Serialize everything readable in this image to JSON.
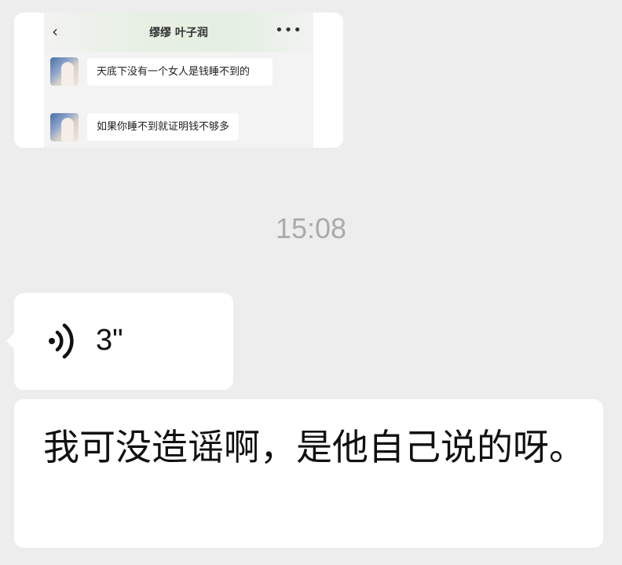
{
  "image_message": {
    "inner_chat": {
      "back_icon": "chevron-left-icon",
      "title": "缪缪 叶子润",
      "more_icon": "more-dots-icon",
      "messages": [
        {
          "text": "天底下没有一个女人是钱睡不到的"
        },
        {
          "text": "如果你睡不到就证明钱不够多"
        }
      ]
    }
  },
  "timestamp": "15:08",
  "voice_message": {
    "icon": "voice-wave-icon",
    "duration": "3\""
  },
  "text_message": {
    "text": "我可没造谣啊，是他自己说的呀。"
  },
  "colors": {
    "background": "#ededed",
    "bubble": "#ffffff",
    "timestamp": "#aaaaaa"
  }
}
